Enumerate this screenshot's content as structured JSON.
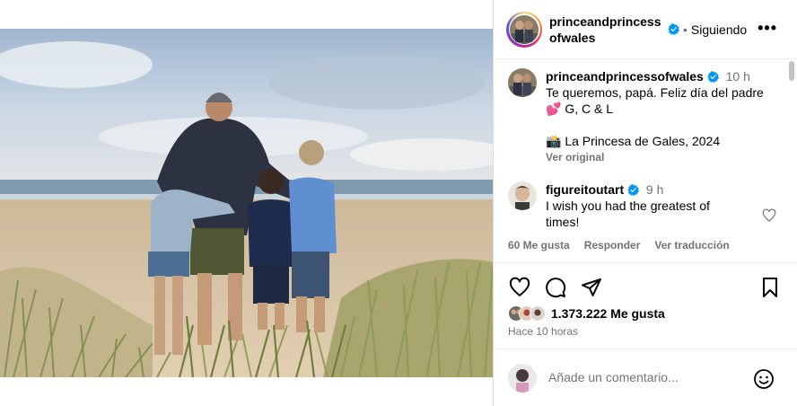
{
  "post": {
    "username_line1": "princeandprincess",
    "username_line2": "ofwales",
    "follow_state": "Siguiendo",
    "separator": "•"
  },
  "caption": {
    "username": "princeandprincessofwales",
    "time": "10 h",
    "text": "Te queremos, papá. Feliz día del padre 💕 G, C & L",
    "credit": "📸 La Princesa de Gales, 2024",
    "see_original": "Ver original"
  },
  "comment": {
    "username": "figureitoutart",
    "time": "9 h",
    "text": "I wish you had the greatest of times!",
    "likes": "60 Me gusta",
    "reply": "Responder",
    "translate": "Ver traducción"
  },
  "actions": {
    "likes_count": "1.373.222 Me gusta",
    "time_ago": "Hace 10 horas"
  },
  "add_comment": {
    "placeholder": "Añade un comentario..."
  },
  "icons": {
    "more": "more-options-icon",
    "verified": "verified-badge-icon",
    "like": "heart-icon",
    "comment": "comment-icon",
    "share": "send-icon",
    "save": "bookmark-icon",
    "emoji": "emoji-icon"
  },
  "colors": {
    "verified": "#0095f6",
    "muted": "#737373",
    "border": "#dbdbdb"
  }
}
